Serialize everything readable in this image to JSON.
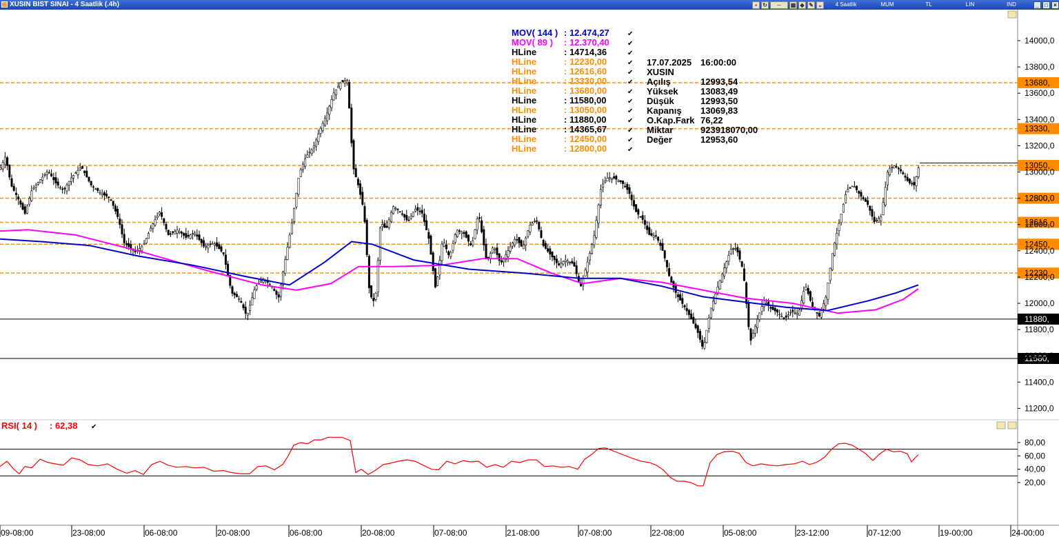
{
  "window": {
    "title": "XUSIN BIST SINAI - 4 Saatlik (.4h)",
    "toolbar": [
      "4 Saatlik",
      "MUM",
      "TL",
      "LIN",
      "IND"
    ]
  },
  "legend": [
    {
      "name": "MOV( 144 )",
      "value": ": 12.474,27",
      "color": "#0000cc"
    },
    {
      "name": "MOV( 89 )",
      "value": ": 12.370,40",
      "color": "#ff00ff"
    },
    {
      "name": "HLine",
      "value": ": 14714,36",
      "color": "#000000"
    },
    {
      "name": "HLine",
      "value": ": 12230,00",
      "color": "#ff8c00"
    },
    {
      "name": "HLine",
      "value": ": 12616,60",
      "color": "#ff8c00"
    },
    {
      "name": "HLine",
      "value": ": 13330,00",
      "color": "#ff8c00"
    },
    {
      "name": "HLine",
      "value": ": 13680,00",
      "color": "#ff8c00"
    },
    {
      "name": "HLine",
      "value": ": 11580,00",
      "color": "#000000"
    },
    {
      "name": "HLine",
      "value": ": 13050,00",
      "color": "#ff8c00"
    },
    {
      "name": "HLine",
      "value": ": 11880,00",
      "color": "#000000"
    },
    {
      "name": "HLine",
      "value": ": 14365,67",
      "color": "#000000"
    },
    {
      "name": "HLine",
      "value": ": 12450,00",
      "color": "#ff8c00"
    },
    {
      "name": "HLine",
      "value": ": 12800,00",
      "color": "#ff8c00"
    }
  ],
  "info": [
    [
      "17.07.2025",
      "16:00:00"
    ],
    [
      "XUSIN",
      ""
    ],
    [
      "Açılış",
      "12993,54"
    ],
    [
      "Yüksek",
      "13083,49"
    ],
    [
      "Düşük",
      "12993,50"
    ],
    [
      "Kapanış",
      "13069,83"
    ],
    [
      "O.Kap.Fark",
      "76,22"
    ],
    [
      "Miktar",
      "923918070,00"
    ],
    [
      "Değer",
      "12953,60"
    ]
  ],
  "rsi_label": {
    "name": "RSI( 14 )",
    "value": ": 62,38"
  },
  "chart_data": [
    {
      "type": "candlestick",
      "ylim": [
        11150,
        14150
      ],
      "yticks": [
        11200,
        11400,
        11600,
        11800,
        12000,
        12200,
        12400,
        12600,
        12800,
        13000,
        13200,
        13400,
        13600,
        13800,
        14000
      ],
      "ytick_labels": [
        "11200,0",
        "11400,0",
        "11600,0",
        "11800,0",
        "12000,0",
        "12200,0",
        "12400,0",
        "12600,0",
        "12800,0",
        "13000,0",
        "13200,0",
        "13400,0",
        "13600,0",
        "13800,0",
        "14000,0"
      ],
      "hlines": [
        {
          "value": 13680,
          "label": "13680,",
          "color": "#ff8c00",
          "style": "dashed"
        },
        {
          "value": 13330,
          "label": "13330,",
          "color": "#ff8c00",
          "style": "dashed"
        },
        {
          "value": 13050,
          "label": "13050,",
          "color": "#ff8c00",
          "style": "dashed"
        },
        {
          "value": 12800,
          "label": "12800,",
          "color": "#ff8c00",
          "style": "dashed"
        },
        {
          "value": 12616.6,
          "label": "12616,",
          "color": "#ff8c00",
          "style": "dashed"
        },
        {
          "value": 12450,
          "label": "12450,",
          "color": "#ff8c00",
          "style": "dashed"
        },
        {
          "value": 12230,
          "label": "12230,",
          "color": "#ff8c00",
          "style": "dashed"
        },
        {
          "value": 11880,
          "label": "11880,",
          "color": "#000000",
          "style": "solid"
        },
        {
          "value": 11580,
          "label": "11580,",
          "color": "#000000",
          "style": "solid"
        }
      ],
      "price_path": [
        [
          0,
          13020
        ],
        [
          8,
          13120
        ],
        [
          16,
          12900
        ],
        [
          26,
          12800
        ],
        [
          36,
          12680
        ],
        [
          46,
          12860
        ],
        [
          60,
          12950
        ],
        [
          70,
          13010
        ],
        [
          80,
          12920
        ],
        [
          92,
          12860
        ],
        [
          104,
          12960
        ],
        [
          118,
          13040
        ],
        [
          132,
          12900
        ],
        [
          146,
          12840
        ],
        [
          160,
          12800
        ],
        [
          172,
          12640
        ],
        [
          180,
          12460
        ],
        [
          196,
          12390
        ],
        [
          208,
          12440
        ],
        [
          220,
          12590
        ],
        [
          232,
          12700
        ],
        [
          244,
          12520
        ],
        [
          258,
          12560
        ],
        [
          270,
          12500
        ],
        [
          282,
          12540
        ],
        [
          296,
          12430
        ],
        [
          310,
          12460
        ],
        [
          324,
          12380
        ],
        [
          336,
          12080
        ],
        [
          348,
          12030
        ],
        [
          358,
          11900
        ],
        [
          370,
          12120
        ],
        [
          382,
          12190
        ],
        [
          394,
          12130
        ],
        [
          404,
          12040
        ],
        [
          414,
          12340
        ],
        [
          424,
          12630
        ],
        [
          434,
          12990
        ],
        [
          444,
          13120
        ],
        [
          454,
          13180
        ],
        [
          464,
          13320
        ],
        [
          474,
          13440
        ],
        [
          484,
          13600
        ],
        [
          494,
          13680
        ],
        [
          504,
          13700
        ],
        [
          512,
          13040
        ],
        [
          520,
          12890
        ],
        [
          528,
          12700
        ],
        [
          536,
          12070
        ],
        [
          544,
          12000
        ],
        [
          552,
          12620
        ],
        [
          560,
          12560
        ],
        [
          570,
          12740
        ],
        [
          580,
          12700
        ],
        [
          592,
          12620
        ],
        [
          602,
          12720
        ],
        [
          612,
          12690
        ],
        [
          622,
          12490
        ],
        [
          632,
          12100
        ],
        [
          642,
          12490
        ],
        [
          652,
          12350
        ],
        [
          662,
          12560
        ],
        [
          672,
          12540
        ],
        [
          684,
          12430
        ],
        [
          694,
          12690
        ],
        [
          706,
          12310
        ],
        [
          716,
          12440
        ],
        [
          726,
          12300
        ],
        [
          738,
          12410
        ],
        [
          748,
          12500
        ],
        [
          758,
          12420
        ],
        [
          768,
          12590
        ],
        [
          778,
          12640
        ],
        [
          788,
          12440
        ],
        [
          800,
          12360
        ],
        [
          810,
          12290
        ],
        [
          820,
          12330
        ],
        [
          832,
          12300
        ],
        [
          842,
          12120
        ],
        [
          852,
          12310
        ],
        [
          862,
          12520
        ],
        [
          872,
          12890
        ],
        [
          882,
          12960
        ],
        [
          892,
          12950
        ],
        [
          902,
          12920
        ],
        [
          912,
          12850
        ],
        [
          922,
          12700
        ],
        [
          932,
          12640
        ],
        [
          942,
          12520
        ],
        [
          952,
          12510
        ],
        [
          962,
          12390
        ],
        [
          972,
          12180
        ],
        [
          982,
          12060
        ],
        [
          992,
          11980
        ],
        [
          1002,
          11890
        ],
        [
          1012,
          11780
        ],
        [
          1020,
          11650
        ],
        [
          1030,
          11940
        ],
        [
          1040,
          12110
        ],
        [
          1050,
          12260
        ],
        [
          1060,
          12410
        ],
        [
          1068,
          12420
        ],
        [
          1078,
          12250
        ],
        [
          1088,
          11700
        ],
        [
          1098,
          11870
        ],
        [
          1108,
          12020
        ],
        [
          1118,
          11960
        ],
        [
          1128,
          11930
        ],
        [
          1138,
          11880
        ],
        [
          1148,
          11940
        ],
        [
          1158,
          11920
        ],
        [
          1168,
          12140
        ],
        [
          1178,
          11980
        ],
        [
          1188,
          11900
        ],
        [
          1198,
          12050
        ],
        [
          1208,
          12400
        ],
        [
          1218,
          12630
        ],
        [
          1228,
          12860
        ],
        [
          1238,
          12900
        ],
        [
          1248,
          12820
        ],
        [
          1258,
          12760
        ],
        [
          1268,
          12620
        ],
        [
          1278,
          12660
        ],
        [
          1288,
          13020
        ],
        [
          1298,
          13050
        ],
        [
          1308,
          13000
        ],
        [
          1318,
          12920
        ],
        [
          1326,
          12900
        ],
        [
          1334,
          13069
        ]
      ],
      "mov144": [
        [
          0,
          12490
        ],
        [
          60,
          12470
        ],
        [
          130,
          12440
        ],
        [
          200,
          12360
        ],
        [
          280,
          12290
        ],
        [
          360,
          12200
        ],
        [
          420,
          12140
        ],
        [
          470,
          12310
        ],
        [
          510,
          12470
        ],
        [
          540,
          12450
        ],
        [
          600,
          12330
        ],
        [
          680,
          12260
        ],
        [
          760,
          12230
        ],
        [
          840,
          12190
        ],
        [
          900,
          12190
        ],
        [
          960,
          12130
        ],
        [
          1020,
          12050
        ],
        [
          1080,
          12010
        ],
        [
          1140,
          11970
        ],
        [
          1200,
          11945
        ],
        [
          1260,
          12020
        ],
        [
          1300,
          12080
        ],
        [
          1332,
          12140
        ]
      ],
      "mov89": [
        [
          0,
          12550
        ],
        [
          40,
          12560
        ],
        [
          110,
          12520
        ],
        [
          200,
          12400
        ],
        [
          300,
          12250
        ],
        [
          380,
          12140
        ],
        [
          430,
          12100
        ],
        [
          480,
          12150
        ],
        [
          520,
          12280
        ],
        [
          570,
          12280
        ],
        [
          640,
          12290
        ],
        [
          700,
          12340
        ],
        [
          750,
          12340
        ],
        [
          800,
          12230
        ],
        [
          845,
          12150
        ],
        [
          900,
          12190
        ],
        [
          960,
          12160
        ],
        [
          1020,
          12100
        ],
        [
          1080,
          12040
        ],
        [
          1150,
          12000
        ],
        [
          1215,
          11925
        ],
        [
          1270,
          11950
        ],
        [
          1310,
          12030
        ],
        [
          1332,
          12110
        ]
      ],
      "xticks": [
        "09-08:00",
        "23-08:00",
        "06-08:00",
        "20-08:00",
        "06-08:00",
        "20-08:00",
        "07-08:00",
        "21-08:00",
        "07-08:00",
        "22-08:00",
        "05-08:00",
        "23-12:00",
        "07-12:00",
        "19-00:00",
        "24-00:00"
      ]
    },
    {
      "type": "line",
      "name": "RSI( 14 )",
      "ylim": [
        10,
        95
      ],
      "yticks": [
        20,
        40,
        60,
        80
      ],
      "ytick_labels": [
        "20,00",
        "40,00",
        "60,00",
        "80,00"
      ],
      "levels": [
        70,
        30
      ],
      "values": [
        [
          0,
          44
        ],
        [
          10,
          52
        ],
        [
          20,
          40
        ],
        [
          28,
          33
        ],
        [
          36,
          44
        ],
        [
          46,
          42
        ],
        [
          58,
          55
        ],
        [
          70,
          50
        ],
        [
          80,
          48
        ],
        [
          92,
          46
        ],
        [
          104,
          57
        ],
        [
          116,
          54
        ],
        [
          128,
          47
        ],
        [
          142,
          45
        ],
        [
          156,
          48
        ],
        [
          170,
          40
        ],
        [
          184,
          34
        ],
        [
          196,
          38
        ],
        [
          208,
          32
        ],
        [
          220,
          47
        ],
        [
          232,
          52
        ],
        [
          244,
          46
        ],
        [
          256,
          43
        ],
        [
          270,
          44
        ],
        [
          282,
          42
        ],
        [
          296,
          43
        ],
        [
          310,
          37
        ],
        [
          324,
          38
        ],
        [
          336,
          35
        ],
        [
          350,
          33
        ],
        [
          362,
          33
        ],
        [
          374,
          44
        ],
        [
          386,
          45
        ],
        [
          398,
          39
        ],
        [
          410,
          47
        ],
        [
          418,
          60
        ],
        [
          426,
          76
        ],
        [
          436,
          80
        ],
        [
          446,
          78
        ],
        [
          456,
          84
        ],
        [
          466,
          84
        ],
        [
          476,
          88
        ],
        [
          486,
          88
        ],
        [
          496,
          88
        ],
        [
          508,
          83
        ],
        [
          516,
          35
        ],
        [
          524,
          40
        ],
        [
          534,
          32
        ],
        [
          544,
          38
        ],
        [
          556,
          47
        ],
        [
          566,
          49
        ],
        [
          578,
          52
        ],
        [
          590,
          54
        ],
        [
          602,
          52
        ],
        [
          614,
          46
        ],
        [
          626,
          40
        ],
        [
          636,
          39
        ],
        [
          648,
          52
        ],
        [
          660,
          48
        ],
        [
          672,
          53
        ],
        [
          682,
          51
        ],
        [
          694,
          52
        ],
        [
          706,
          43
        ],
        [
          718,
          47
        ],
        [
          730,
          43
        ],
        [
          742,
          52
        ],
        [
          754,
          50
        ],
        [
          766,
          54
        ],
        [
          778,
          54
        ],
        [
          790,
          44
        ],
        [
          802,
          45
        ],
        [
          814,
          43
        ],
        [
          826,
          44
        ],
        [
          838,
          40
        ],
        [
          848,
          55
        ],
        [
          858,
          62
        ],
        [
          868,
          71
        ],
        [
          878,
          72
        ],
        [
          888,
          68
        ],
        [
          898,
          64
        ],
        [
          908,
          60
        ],
        [
          918,
          56
        ],
        [
          930,
          52
        ],
        [
          942,
          50
        ],
        [
          952,
          46
        ],
        [
          962,
          39
        ],
        [
          972,
          28
        ],
        [
          982,
          22
        ],
        [
          992,
          22
        ],
        [
          1002,
          20
        ],
        [
          1012,
          15
        ],
        [
          1020,
          15
        ],
        [
          1030,
          50
        ],
        [
          1040,
          62
        ],
        [
          1050,
          66
        ],
        [
          1062,
          67
        ],
        [
          1072,
          64
        ],
        [
          1082,
          50
        ],
        [
          1092,
          45
        ],
        [
          1104,
          48
        ],
        [
          1116,
          46
        ],
        [
          1128,
          45
        ],
        [
          1140,
          47
        ],
        [
          1152,
          48
        ],
        [
          1164,
          52
        ],
        [
          1174,
          47
        ],
        [
          1184,
          50
        ],
        [
          1196,
          58
        ],
        [
          1206,
          70
        ],
        [
          1216,
          78
        ],
        [
          1226,
          79
        ],
        [
          1236,
          76
        ],
        [
          1246,
          70
        ],
        [
          1256,
          63
        ],
        [
          1266,
          53
        ],
        [
          1276,
          63
        ],
        [
          1286,
          70
        ],
        [
          1296,
          66
        ],
        [
          1306,
          67
        ],
        [
          1316,
          63
        ],
        [
          1322,
          51
        ],
        [
          1332,
          62
        ]
      ],
      "value_label": "62,38"
    }
  ]
}
